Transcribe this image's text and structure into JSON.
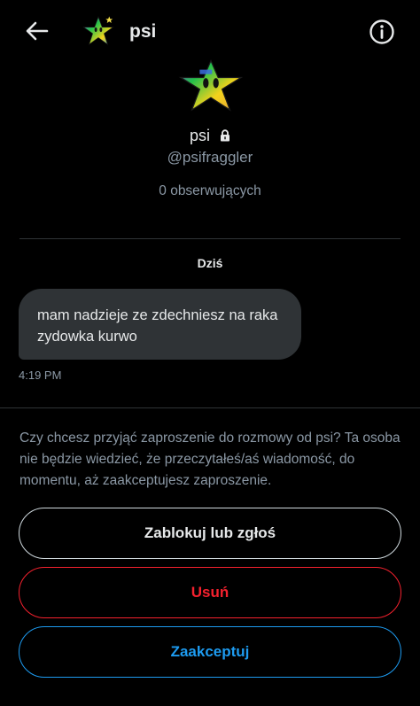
{
  "header": {
    "title": "psi",
    "back_icon": "arrow-left-icon",
    "info_icon": "info-circle-icon"
  },
  "profile": {
    "name": "psi",
    "handle": "@psifraggler",
    "followers": "0 obserwujących",
    "locked_icon": "lock-icon"
  },
  "conversation": {
    "date_label": "Dziś",
    "messages": [
      {
        "text": "mam nadzieje ze zdechniesz na raka zydowka kurwo",
        "time": "4:19 PM"
      }
    ]
  },
  "request": {
    "text": "Czy chcesz przyjąć zaproszenie do rozmowy od psi? Ta osoba nie będzie wiedzieć, że przeczytałeś/aś wiadomość, do momentu, aż zaakceptujesz zaproszenie."
  },
  "actions": {
    "block_label": "Zablokuj lub zgłoś",
    "delete_label": "Usuń",
    "accept_label": "Zaakceptuj"
  },
  "colors": {
    "background": "#000000",
    "bubble": "#2f3336",
    "secondary_text": "#8b98a5",
    "danger": "#f4212e",
    "accent": "#1d9bf0"
  }
}
